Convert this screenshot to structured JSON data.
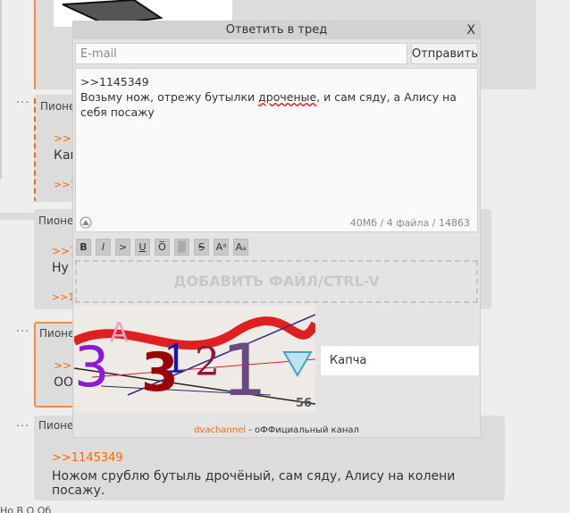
{
  "thread": {
    "posts": [
      {
        "author": "Пионе",
        "link": ">>1",
        "text": "Кап",
        "link2": ">>1"
      },
      {
        "author": "Пионе",
        "link": ">>1",
        "text": "Ну",
        "link2": ">>1"
      },
      {
        "author": "Пионе",
        "link": ">>1",
        "text": "ОО"
      }
    ],
    "last_post": {
      "author": "Пионе",
      "reply_ref": ">>1145349",
      "body": "Ножом срублю бутыль дрочёный, сам сяду, Алису на колени посажу."
    },
    "footer": "Но  В  О  Об"
  },
  "modal": {
    "title": "Ответить в тред",
    "close": "X",
    "email_placeholder": "E-mail",
    "send_label": "Отправить",
    "message_line1": ">>1145349",
    "message_line2a": "Возьму нож, отрежу бутылки ",
    "message_misspelled": "дроченые",
    "message_line2b": ", и сам сяду, а Алису на себя посажу",
    "counter": "40Мб / 4 файла / 14863",
    "toolbar": [
      "B",
      "I",
      ">",
      "U",
      "O̅",
      "█",
      "S",
      "Aᵃ",
      "Aₐ"
    ],
    "dropzone": "ДОБАВИТЬ ФАЙЛ/CTRL-V",
    "captcha_placeholder": "Капча",
    "captcha_digits": "3 3 1 2 1",
    "captcha_number": "56",
    "channel_name": "dvachannel",
    "channel_suffix": " - оФФициальный канал"
  },
  "colors": {
    "accent": "#ff6600",
    "panel": "#e4e4e4",
    "post": "#dcdcdc"
  }
}
